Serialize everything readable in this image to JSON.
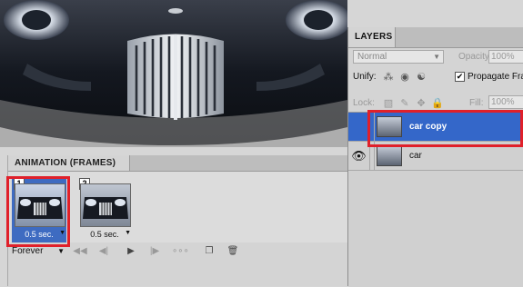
{
  "animation_panel": {
    "tab_title": "ANIMATION (FRAMES)",
    "frames": [
      {
        "number": "1",
        "delay": "0.5 sec.",
        "selected": true
      },
      {
        "number": "2",
        "delay": "0.5 sec.",
        "selected": false
      }
    ],
    "loop_option": "Forever",
    "toolbar_icons": [
      "first-frame-icon",
      "previous-frame-icon",
      "play-icon",
      "next-frame-icon",
      "tween-icon",
      "duplicate-frame-icon",
      "delete-frame-icon"
    ]
  },
  "layers_panel": {
    "tab_title": "LAYERS",
    "blend_mode": "Normal",
    "opacity_label": "Opacity:",
    "opacity_value": "100%",
    "unify_label": "Unify:",
    "propagate_label": "Propagate Fra",
    "propagate_checked": true,
    "lock_label": "Lock:",
    "fill_label": "Fill:",
    "fill_value": "100%",
    "layers": [
      {
        "name": "car copy",
        "selected": true,
        "visible": false
      },
      {
        "name": "car",
        "selected": false,
        "visible": true
      }
    ]
  },
  "colors": {
    "selection": "#3467c9",
    "highlight": "#e0202a",
    "panel": "#d4d4d4"
  }
}
